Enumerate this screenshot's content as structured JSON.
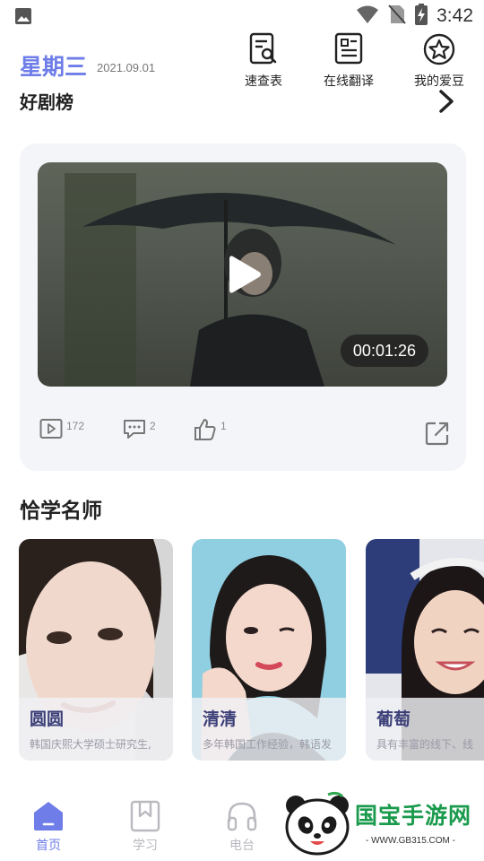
{
  "status_bar": {
    "time": "3:42"
  },
  "header": {
    "weekday": "星期三",
    "date": "2021.09.01",
    "section": "好剧榜"
  },
  "quick_actions": [
    {
      "label": "速查表",
      "icon": "search-document-icon"
    },
    {
      "label": "在线翻译",
      "icon": "translate-document-icon"
    },
    {
      "label": "我的爱豆",
      "icon": "star-circle-icon"
    }
  ],
  "video": {
    "duration": "00:01:26",
    "plays": "172",
    "comments": "2",
    "likes": "1"
  },
  "teachers": {
    "title": "恰学名师",
    "items": [
      {
        "name": "圆圆",
        "desc": "韩国庆熙大学硕士研究生,"
      },
      {
        "name": "清清",
        "desc": "多年韩国工作经验，韩语发"
      },
      {
        "name": "葡萄",
        "desc": "具有丰富的线下、线"
      }
    ]
  },
  "bottom_nav": [
    {
      "label": "首页",
      "icon": "home-icon",
      "active": true
    },
    {
      "label": "学习",
      "icon": "bookmark-icon",
      "active": false
    },
    {
      "label": "电台",
      "icon": "headphones-icon",
      "active": false
    }
  ],
  "watermark": {
    "text": "国宝手游网",
    "url": "- WWW.GB315.COM -"
  },
  "colors": {
    "accent": "#6e7de8",
    "nav_inactive": "#b9b9c0"
  }
}
